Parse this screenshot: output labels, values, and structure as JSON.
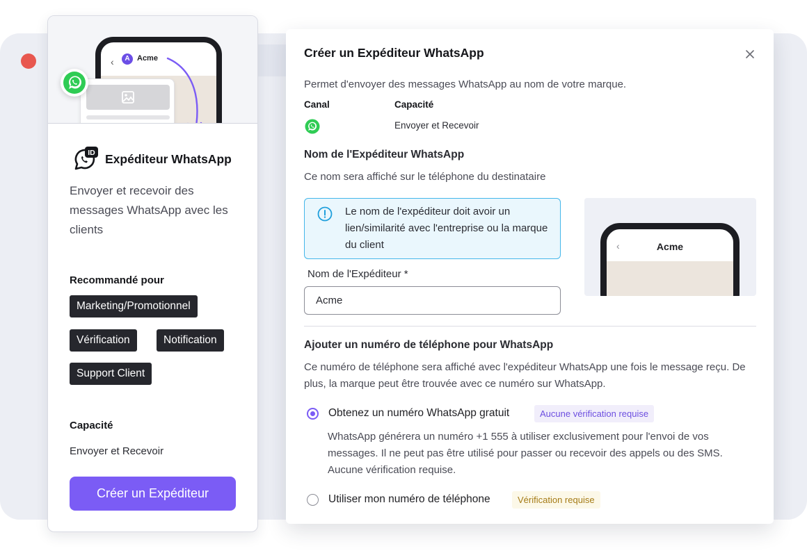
{
  "colors": {
    "accent": "#7b5cf5",
    "whatsapp_green": "#2fcc54",
    "info_border": "#43b6ea",
    "close_dot": "#e8574f"
  },
  "left_card": {
    "preview_sender": "Acme",
    "preview_avatar_letter": "A",
    "title": "Expéditeur WhatsApp",
    "description": "Envoyer et recevoir des messages WhatsApp avec les clients",
    "recommended_label": "Recommandé pour",
    "tags": [
      "Marketing/Promotionnel",
      "Vérification",
      "Notification",
      "Support Client"
    ],
    "capability_label": "Capacité",
    "capability_value": "Envoyer et Recevoir",
    "cta_label": "Créer un Expéditeur"
  },
  "modal": {
    "title": "Créer un Expéditeur WhatsApp",
    "intro": "Permet d'envoyer des messages WhatsApp au nom de votre marque.",
    "channel_header": "Canal",
    "capability_header": "Capacité",
    "channel_icon": "whatsapp-icon",
    "capability_value": "Envoyer et Recevoir",
    "sender_section_title": "Nom de l'Expéditeur WhatsApp",
    "sender_section_desc": "Ce nom sera affiché sur le téléphone du destinataire",
    "alert_text": "Le nom de l'expéditeur doit avoir un lien/similarité avec l'entreprise ou la marque du client",
    "sender_field_label": "Nom de l'Expéditeur *",
    "sender_field_value": "Acme",
    "preview_sender": "Acme",
    "phone_section_title": "Ajouter un numéro de téléphone pour WhatsApp",
    "phone_section_desc": "Ce numéro de téléphone sera affiché avec l'expéditeur WhatsApp une fois le message reçu. De plus, la marque peut être trouvée avec ce numéro sur WhatsApp.",
    "options": [
      {
        "label": "Obtenez un numéro WhatsApp gratuit",
        "badge": "Aucune vérification requise",
        "selected": true,
        "description": "WhatsApp générera un numéro +1 555 à utiliser exclusivement pour l'envoi de vos messages. Il ne peut pas être utilisé pour passer ou recevoir des appels ou des SMS. Aucune vérification requise."
      },
      {
        "label": "Utiliser mon numéro de téléphone",
        "badge": "Vérification requise",
        "selected": false
      }
    ]
  }
}
